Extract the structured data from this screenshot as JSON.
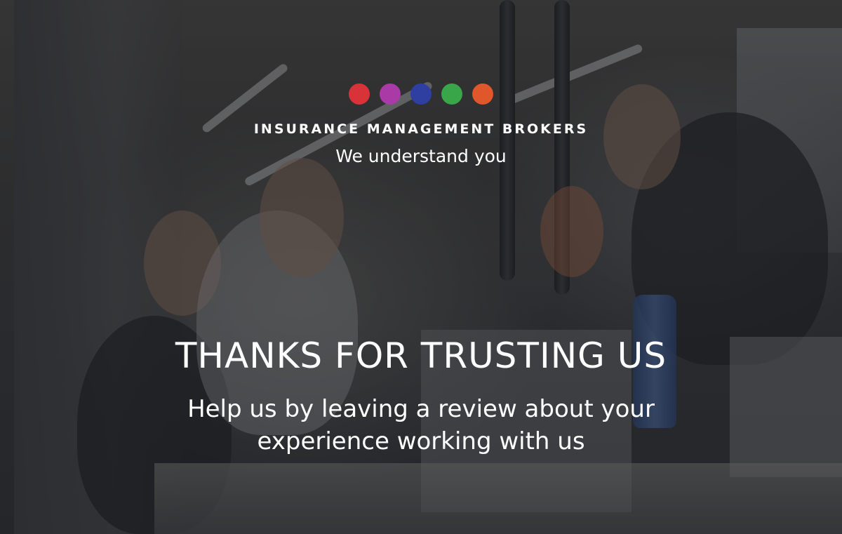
{
  "logo": {
    "dot_colors": [
      "#d9333a",
      "#a93aa6",
      "#2e3fa1",
      "#3aa64a",
      "#e0572b"
    ]
  },
  "brand": {
    "name": "INSURANCE MANAGEMENT BROKERS",
    "tagline": "We understand you"
  },
  "message": {
    "headline": "THANKS FOR TRUSTING US",
    "subline_1": "Help us by leaving a review about your",
    "subline_2": "experience working with us"
  }
}
